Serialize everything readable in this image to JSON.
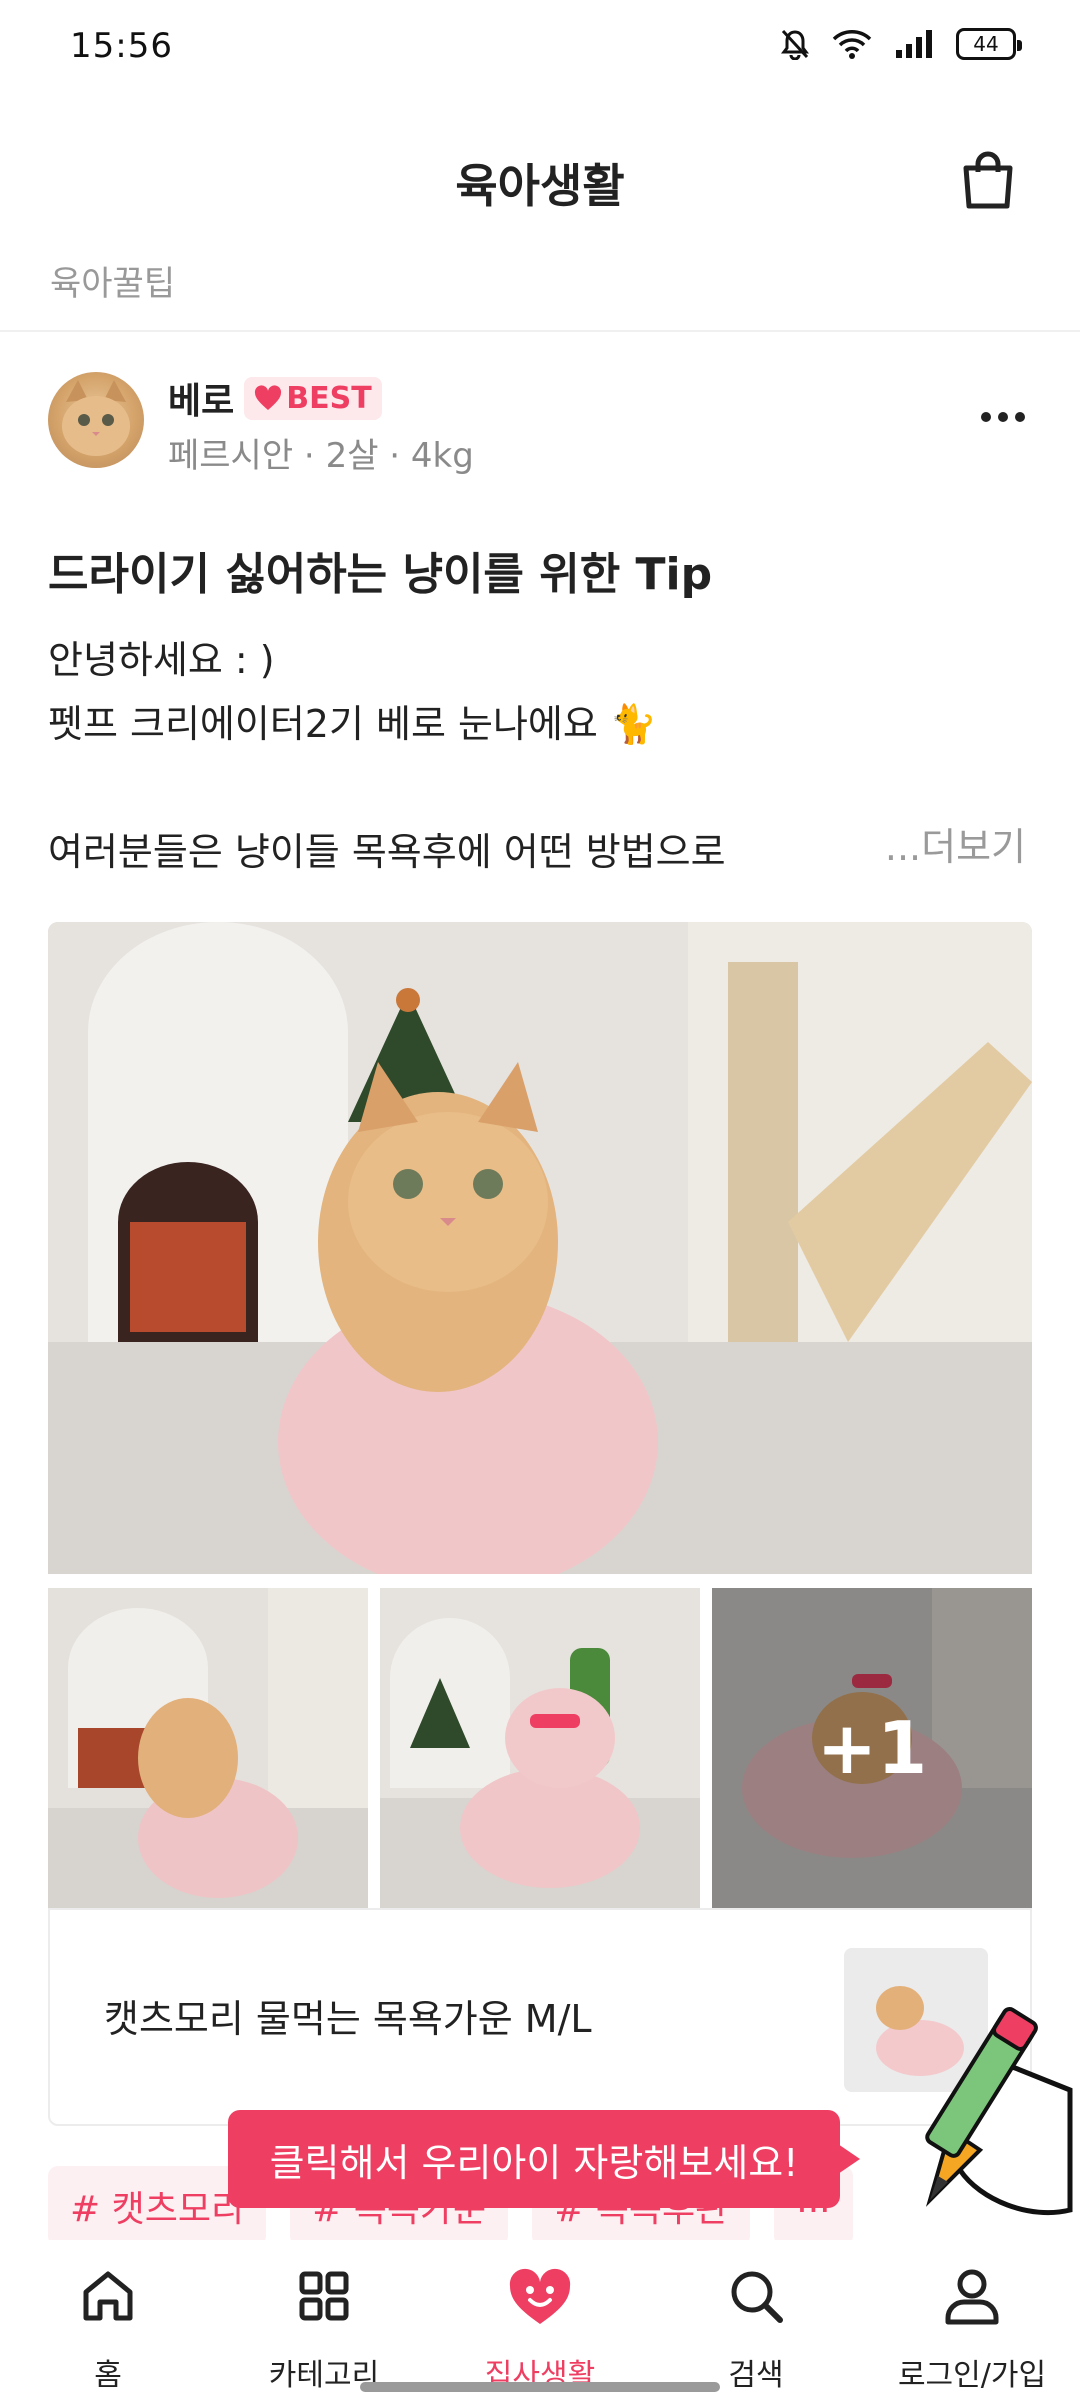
{
  "status_bar": {
    "time": "15:56",
    "battery": "44"
  },
  "header": {
    "title": "육아생활"
  },
  "sub_nav": {
    "label": "육아꿀팁"
  },
  "author": {
    "name": "베로",
    "badge": "BEST",
    "breed": "페르시안",
    "age": "2살",
    "weight": "4kg"
  },
  "post": {
    "title": "드라이기 싫어하는 냥이를 위한 Tip",
    "lines": [
      "안녕하세요 : )",
      "펫프 크리에이터2기 베로 눈나에요 🐈",
      "",
      "여러분들은 냥이들 목욕후에 어떤 방법으로"
    ],
    "read_more": "...더보기"
  },
  "gallery": {
    "more_count": "+1"
  },
  "product": {
    "name": "캣츠모리 물먹는 목욕가운 M/L"
  },
  "tags": [
    "# 캣츠모리",
    "# 목욕가운",
    "# 목욕후관",
    "..."
  ],
  "tooltip": {
    "text": "클릭해서 우리아이 자랑해보세요!"
  },
  "bottom_nav": {
    "items": [
      {
        "label": "홈",
        "icon": "home-icon"
      },
      {
        "label": "카테고리",
        "icon": "grid-icon"
      },
      {
        "label": "집사생활",
        "icon": "heart-face-icon"
      },
      {
        "label": "검색",
        "icon": "search-icon"
      },
      {
        "label": "로그인/가입",
        "icon": "person-icon"
      }
    ],
    "active_index": 2
  },
  "colors": {
    "accent": "#ee3f63",
    "muted": "#999999",
    "text": "#222222"
  }
}
